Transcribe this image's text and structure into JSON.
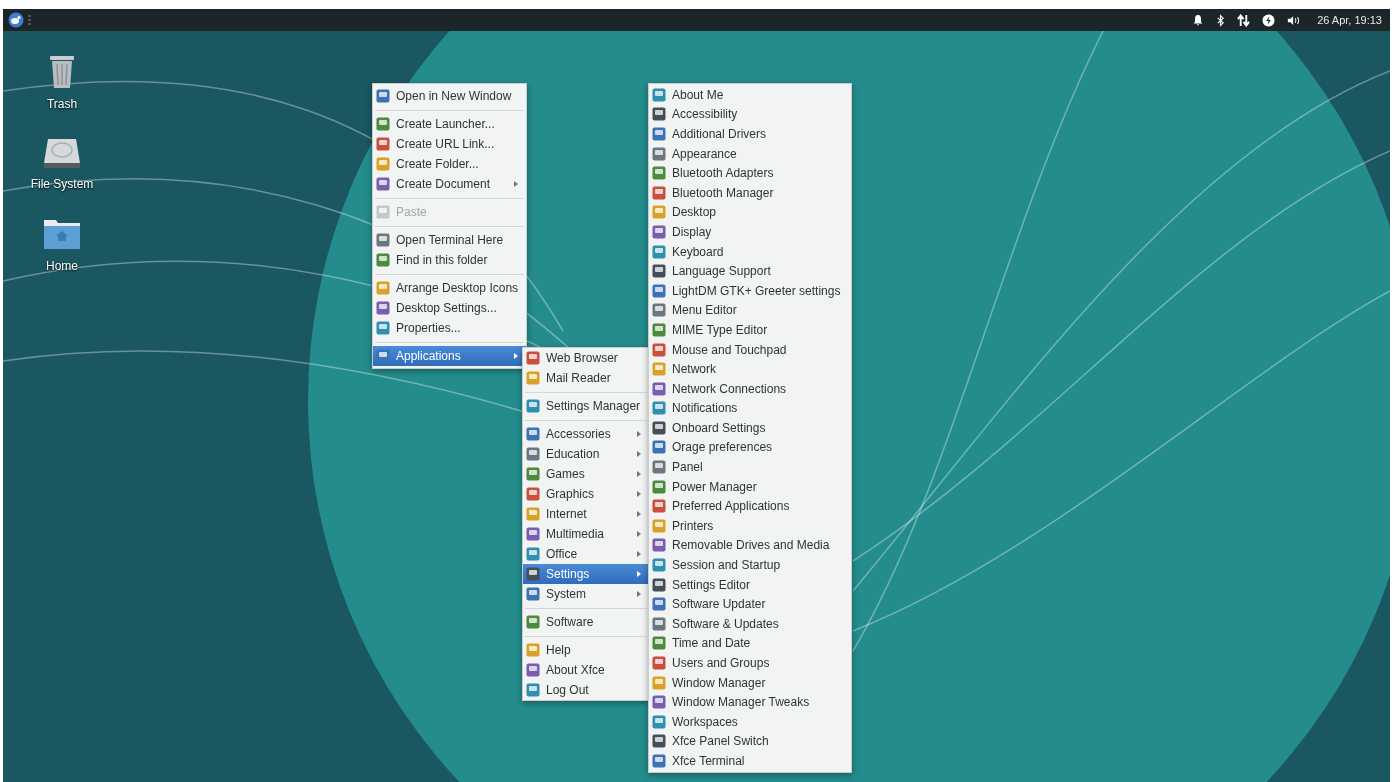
{
  "panel": {
    "clock": "26 Apr, 19:13"
  },
  "desktop_icons": [
    {
      "kind": "trash",
      "label": "Trash"
    },
    {
      "kind": "drive",
      "label": "File System"
    },
    {
      "kind": "folder",
      "label": "Home"
    }
  ],
  "menus": [
    {
      "items": [
        {
          "kind": "item",
          "label": "Open in New Window",
          "submenu": false,
          "disabled": false,
          "selected": false
        },
        {
          "kind": "separator"
        },
        {
          "kind": "item",
          "label": "Create Launcher...",
          "submenu": false,
          "disabled": false,
          "selected": false
        },
        {
          "kind": "item",
          "label": "Create URL Link...",
          "submenu": false,
          "disabled": false,
          "selected": false
        },
        {
          "kind": "item",
          "label": "Create Folder...",
          "submenu": false,
          "disabled": false,
          "selected": false
        },
        {
          "kind": "item",
          "label": "Create Document",
          "submenu": true,
          "disabled": false,
          "selected": false
        },
        {
          "kind": "separator"
        },
        {
          "kind": "item",
          "label": "Paste",
          "submenu": false,
          "disabled": true,
          "selected": false
        },
        {
          "kind": "separator"
        },
        {
          "kind": "item",
          "label": "Open Terminal Here",
          "submenu": false,
          "disabled": false,
          "selected": false
        },
        {
          "kind": "item",
          "label": "Find in this folder",
          "submenu": false,
          "disabled": false,
          "selected": false
        },
        {
          "kind": "separator"
        },
        {
          "kind": "item",
          "label": "Arrange Desktop Icons",
          "submenu": false,
          "disabled": false,
          "selected": false
        },
        {
          "kind": "item",
          "label": "Desktop Settings...",
          "submenu": false,
          "disabled": false,
          "selected": false
        },
        {
          "kind": "item",
          "label": "Properties...",
          "submenu": false,
          "disabled": false,
          "selected": false
        },
        {
          "kind": "separator"
        },
        {
          "kind": "item",
          "label": "Applications",
          "submenu": true,
          "disabled": false,
          "selected": true
        }
      ]
    },
    {
      "items": [
        {
          "kind": "item",
          "label": "Web Browser",
          "submenu": false,
          "disabled": false,
          "selected": false
        },
        {
          "kind": "item",
          "label": "Mail Reader",
          "submenu": false,
          "disabled": false,
          "selected": false
        },
        {
          "kind": "separator"
        },
        {
          "kind": "item",
          "label": "Settings Manager",
          "submenu": false,
          "disabled": false,
          "selected": false
        },
        {
          "kind": "separator"
        },
        {
          "kind": "item",
          "label": "Accessories",
          "submenu": true,
          "disabled": false,
          "selected": false
        },
        {
          "kind": "item",
          "label": "Education",
          "submenu": true,
          "disabled": false,
          "selected": false
        },
        {
          "kind": "item",
          "label": "Games",
          "submenu": true,
          "disabled": false,
          "selected": false
        },
        {
          "kind": "item",
          "label": "Graphics",
          "submenu": true,
          "disabled": false,
          "selected": false
        },
        {
          "kind": "item",
          "label": "Internet",
          "submenu": true,
          "disabled": false,
          "selected": false
        },
        {
          "kind": "item",
          "label": "Multimedia",
          "submenu": true,
          "disabled": false,
          "selected": false
        },
        {
          "kind": "item",
          "label": "Office",
          "submenu": true,
          "disabled": false,
          "selected": false
        },
        {
          "kind": "item",
          "label": "Settings",
          "submenu": true,
          "disabled": false,
          "selected": true
        },
        {
          "kind": "item",
          "label": "System",
          "submenu": true,
          "disabled": false,
          "selected": false
        },
        {
          "kind": "separator"
        },
        {
          "kind": "item",
          "label": "Software",
          "submenu": false,
          "disabled": false,
          "selected": false
        },
        {
          "kind": "separator"
        },
        {
          "kind": "item",
          "label": "Help",
          "submenu": false,
          "disabled": false,
          "selected": false
        },
        {
          "kind": "item",
          "label": "About Xfce",
          "submenu": false,
          "disabled": false,
          "selected": false
        },
        {
          "kind": "item",
          "label": "Log Out",
          "submenu": false,
          "disabled": false,
          "selected": false
        }
      ]
    },
    {
      "items": [
        {
          "kind": "item",
          "label": "About Me",
          "submenu": false,
          "disabled": false,
          "selected": false
        },
        {
          "kind": "item",
          "label": "Accessibility",
          "submenu": false,
          "disabled": false,
          "selected": false
        },
        {
          "kind": "item",
          "label": "Additional Drivers",
          "submenu": false,
          "disabled": false,
          "selected": false
        },
        {
          "kind": "item",
          "label": "Appearance",
          "submenu": false,
          "disabled": false,
          "selected": false
        },
        {
          "kind": "item",
          "label": "Bluetooth Adapters",
          "submenu": false,
          "disabled": false,
          "selected": false
        },
        {
          "kind": "item",
          "label": "Bluetooth Manager",
          "submenu": false,
          "disabled": false,
          "selected": false
        },
        {
          "kind": "item",
          "label": "Desktop",
          "submenu": false,
          "disabled": false,
          "selected": false
        },
        {
          "kind": "item",
          "label": "Display",
          "submenu": false,
          "disabled": false,
          "selected": false
        },
        {
          "kind": "item",
          "label": "Keyboard",
          "submenu": false,
          "disabled": false,
          "selected": false
        },
        {
          "kind": "item",
          "label": "Language Support",
          "submenu": false,
          "disabled": false,
          "selected": false
        },
        {
          "kind": "item",
          "label": "LightDM GTK+ Greeter settings",
          "submenu": false,
          "disabled": false,
          "selected": false
        },
        {
          "kind": "item",
          "label": "Menu Editor",
          "submenu": false,
          "disabled": false,
          "selected": false
        },
        {
          "kind": "item",
          "label": "MIME Type Editor",
          "submenu": false,
          "disabled": false,
          "selected": false
        },
        {
          "kind": "item",
          "label": "Mouse and Touchpad",
          "submenu": false,
          "disabled": false,
          "selected": false
        },
        {
          "kind": "item",
          "label": "Network",
          "submenu": false,
          "disabled": false,
          "selected": false
        },
        {
          "kind": "item",
          "label": "Network Connections",
          "submenu": false,
          "disabled": false,
          "selected": false
        },
        {
          "kind": "item",
          "label": "Notifications",
          "submenu": false,
          "disabled": false,
          "selected": false
        },
        {
          "kind": "item",
          "label": "Onboard Settings",
          "submenu": false,
          "disabled": false,
          "selected": false
        },
        {
          "kind": "item",
          "label": "Orage preferences",
          "submenu": false,
          "disabled": false,
          "selected": false
        },
        {
          "kind": "item",
          "label": "Panel",
          "submenu": false,
          "disabled": false,
          "selected": false
        },
        {
          "kind": "item",
          "label": "Power Manager",
          "submenu": false,
          "disabled": false,
          "selected": false
        },
        {
          "kind": "item",
          "label": "Preferred Applications",
          "submenu": false,
          "disabled": false,
          "selected": false
        },
        {
          "kind": "item",
          "label": "Printers",
          "submenu": false,
          "disabled": false,
          "selected": false
        },
        {
          "kind": "item",
          "label": "Removable Drives and Media",
          "submenu": false,
          "disabled": false,
          "selected": false
        },
        {
          "kind": "item",
          "label": "Session and Startup",
          "submenu": false,
          "disabled": false,
          "selected": false
        },
        {
          "kind": "item",
          "label": "Settings Editor",
          "submenu": false,
          "disabled": false,
          "selected": false
        },
        {
          "kind": "item",
          "label": "Software Updater",
          "submenu": false,
          "disabled": false,
          "selected": false
        },
        {
          "kind": "item",
          "label": "Software & Updates",
          "submenu": false,
          "disabled": false,
          "selected": false
        },
        {
          "kind": "item",
          "label": "Time and Date",
          "submenu": false,
          "disabled": false,
          "selected": false
        },
        {
          "kind": "item",
          "label": "Users and Groups",
          "submenu": false,
          "disabled": false,
          "selected": false
        },
        {
          "kind": "item",
          "label": "Window Manager",
          "submenu": false,
          "disabled": false,
          "selected": false
        },
        {
          "kind": "item",
          "label": "Window Manager Tweaks",
          "submenu": false,
          "disabled": false,
          "selected": false
        },
        {
          "kind": "item",
          "label": "Workspaces",
          "submenu": false,
          "disabled": false,
          "selected": false
        },
        {
          "kind": "item",
          "label": "Xfce Panel Switch",
          "submenu": false,
          "disabled": false,
          "selected": false
        },
        {
          "kind": "item",
          "label": "Xfce Terminal",
          "submenu": false,
          "disabled": false,
          "selected": false
        }
      ]
    }
  ]
}
